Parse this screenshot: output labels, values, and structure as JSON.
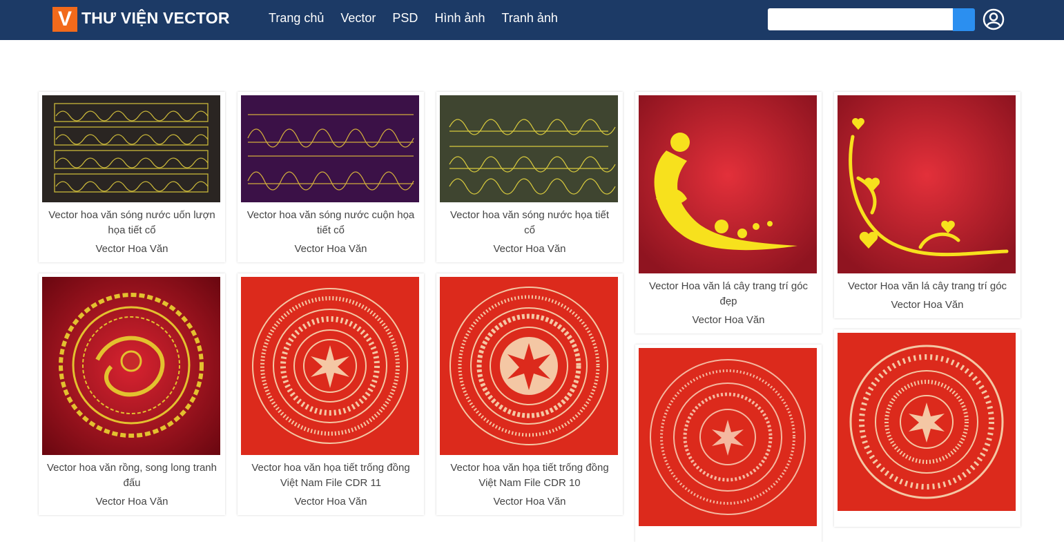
{
  "header": {
    "logo_letter": "V",
    "site_title": "THƯ VIỆN VECTOR",
    "nav": [
      "Trang chủ",
      "Vector",
      "PSD",
      "Hình ảnh",
      "Tranh ảnh"
    ],
    "search_placeholder": "",
    "colors": {
      "bar": "#1c3a66",
      "logo": "#f26a1b",
      "search_button": "#2b8ff0"
    }
  },
  "cards": [
    {
      "title": "Vector hoa văn sóng nước uốn lượn họa tiết cổ",
      "category": "Vector Hoa Văn",
      "thumb_bg": "#2a2522"
    },
    {
      "title": "Vector hoa văn sóng nước cuộn họa tiết cổ",
      "category": "Vector Hoa Văn",
      "thumb_bg": "#3b1147"
    },
    {
      "title": "Vector hoa văn sóng nước họa tiết cổ",
      "category": "Vector Hoa Văn",
      "thumb_bg": "#3f4530"
    },
    {
      "title": "Vector Hoa văn lá cây trang trí góc đẹp",
      "category": "Vector Hoa Văn",
      "thumb_bg": "#a8192a"
    },
    {
      "title": "Vector Hoa văn lá cây trang trí góc",
      "category": "Vector Hoa Văn",
      "thumb_bg": "#a8192a"
    },
    {
      "title": "Vector hoa văn rồng, song long tranh đấu",
      "category": "Vector Hoa Văn",
      "thumb_bg": "#9c0b17"
    },
    {
      "title": "Vector hoa văn họa tiết trống đồng Việt Nam File CDR 11",
      "category": "Vector Hoa Văn",
      "thumb_bg": "#dc2a1c"
    },
    {
      "title": "Vector hoa văn họa tiết trống đồng Việt Nam File CDR 10",
      "category": "Vector Hoa Văn",
      "thumb_bg": "#dc2a1c"
    },
    {
      "title": "",
      "category": "",
      "thumb_bg": "#dc2a1c"
    },
    {
      "title": "",
      "category": "",
      "thumb_bg": "#dc2a1c"
    }
  ]
}
